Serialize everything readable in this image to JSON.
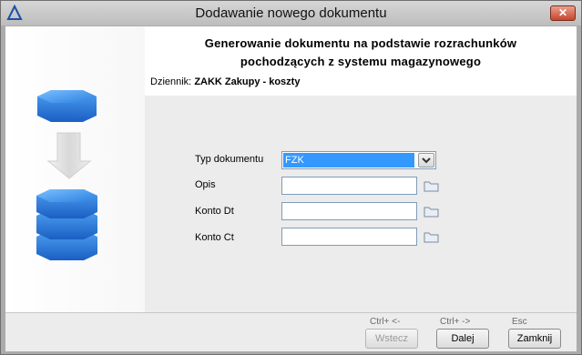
{
  "window": {
    "title": "Dodawanie nowego dokumentu"
  },
  "header": {
    "title_line1": "Generowanie dokumentu na podstawie rozrachunków",
    "title_line2": "pochodzących z systemu magazynowego"
  },
  "journal": {
    "label": "Dziennik:",
    "value": "ZAKK Zakupy - koszty"
  },
  "form": {
    "doc_type_label": "Typ dokumentu",
    "doc_type_value": "FZK",
    "description_label": "Opis",
    "description_value": "",
    "debit_account_label": "Konto Dt",
    "debit_account_value": "",
    "credit_account_label": "Konto Ct",
    "credit_account_value": ""
  },
  "footer": {
    "back_shortcut": "Ctrl+ <-",
    "next_shortcut": "Ctrl+ ->",
    "close_shortcut": "Esc",
    "back_label": "Wstecz",
    "next_label": "Dalej",
    "close_label": "Zamknij"
  },
  "icons": {
    "app": "delta-icon",
    "close": "close-icon",
    "dropdown": "chevron-down-icon",
    "browse": "folder-icon",
    "illustration": "database-transfer-illustration"
  },
  "colors": {
    "selection": "#3399ff",
    "close_button": "#c7452c",
    "illustration_blue": "#1f74d8"
  }
}
